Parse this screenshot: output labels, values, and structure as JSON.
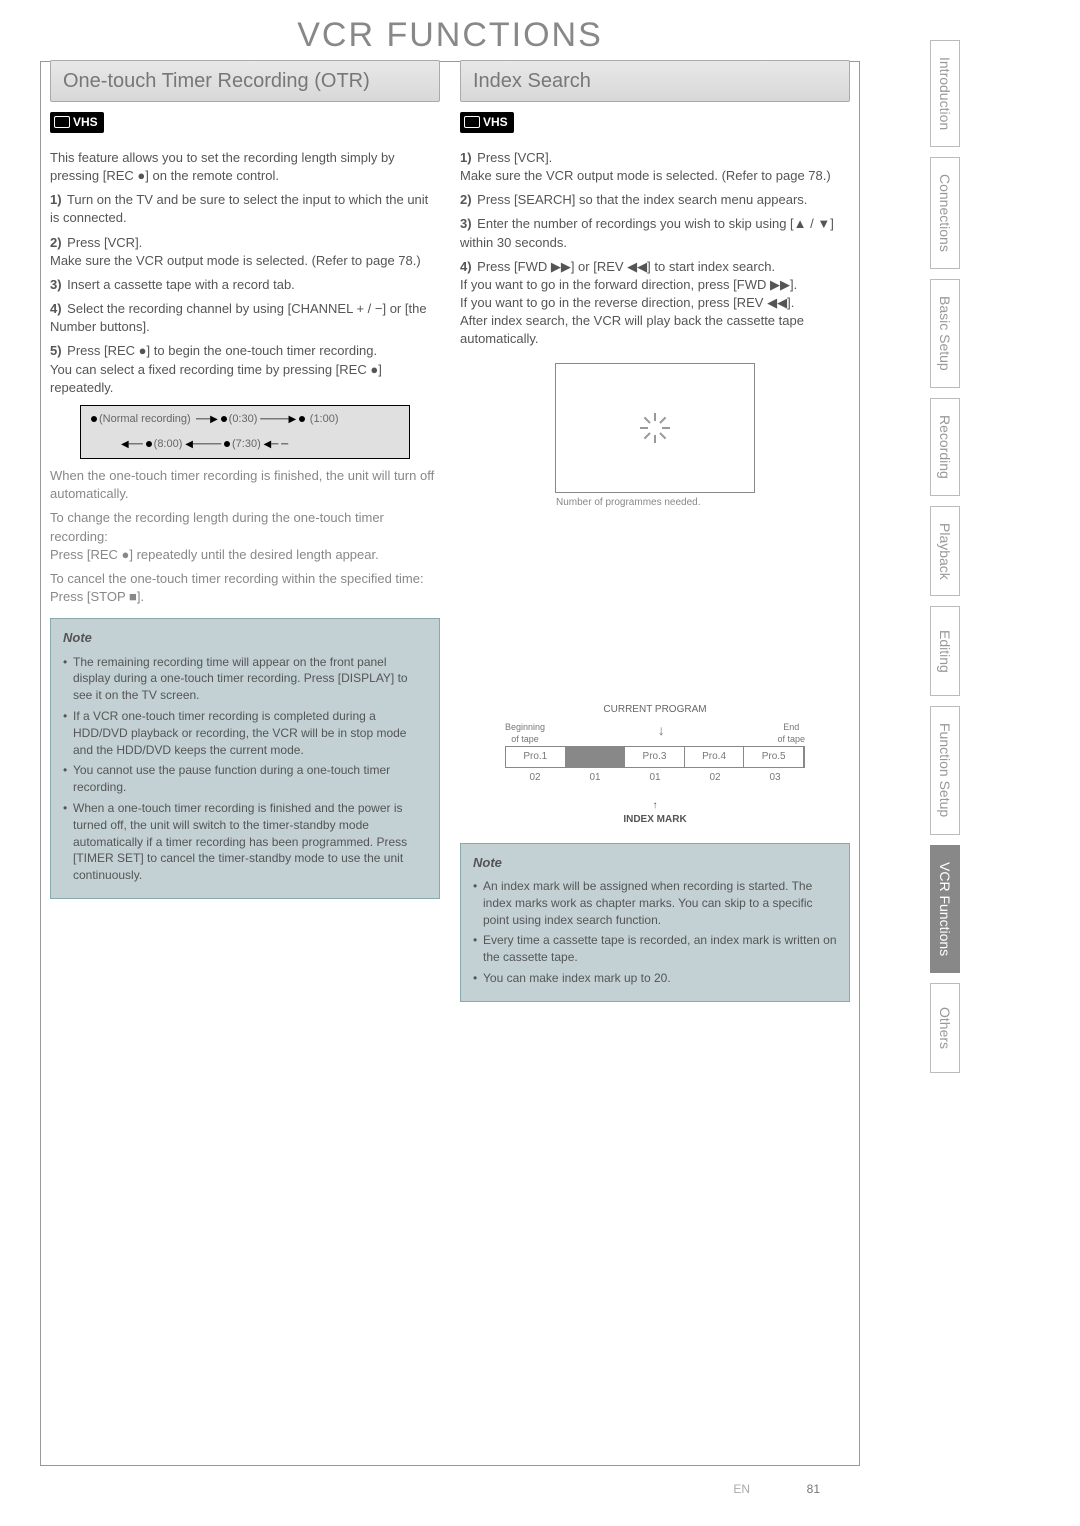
{
  "page_title": "VCR FUNCTIONS",
  "left": {
    "header": "One-touch Timer Recording (OTR)",
    "badge": "VHS",
    "intro": "This feature allows you to set the recording length simply by pressing [REC ●] on the remote control.",
    "steps": [
      "Turn on the TV and be sure to select the input to which the unit is connected.",
      "Press [VCR].\nMake sure the VCR output mode is selected. (Refer to page 78.)",
      "Insert a cassette tape with a record tab.",
      "Select the recording channel by using [CHANNEL + / −] or [the Number buttons].",
      "Press [REC ●] to begin the one-touch timer recording.\nYou can select a fixed recording time by pressing [REC ●] repeatedly."
    ],
    "timing_labels": {
      "normal": "(Normal recording)",
      "t030": "(0:30)",
      "t100": "(1:00)",
      "t730": "(7:30)",
      "t800": "(8:00)"
    },
    "after": "When the one-touch timer recording is finished, the unit will turn off automatically.",
    "change": "To change the recording length during the one-touch timer recording:\nPress [REC ●] repeatedly until the desired length appear.",
    "cancel": "To cancel the one-touch timer recording within the specified time:\nPress [STOP ■].",
    "note_title": "Note",
    "notes": [
      "The remaining recording time will appear on the front panel display during a one-touch timer recording. Press [DISPLAY] to see it on the TV screen.",
      "If a VCR one-touch timer recording is completed during a HDD/DVD playback or recording, the VCR will be in stop mode and the HDD/DVD keeps the current mode.",
      "You cannot use the pause function during a one-touch timer recording.",
      "When a one-touch timer recording is finished and the power is turned off, the unit will switch to the timer-standby mode automatically if a timer recording has been programmed. Press [TIMER SET] to cancel the timer-standby mode to use the unit continuously."
    ]
  },
  "right": {
    "header": "Index Search",
    "badge": "VHS",
    "steps": [
      "Press [VCR].\nMake sure the VCR output mode is selected. (Refer to page 78.)",
      "Press [SEARCH] so that the index search menu appears.",
      "Enter the number of recordings you wish to skip using [▲ / ▼] within 30 seconds.",
      "Press [FWD ▶▶] or [REV ◀◀] to start index search.\nIf you want to go in the forward direction, press [FWD ▶▶].\nIf you want to go in the reverse direction, press [REV ◀◀].\nAfter index search, the VCR will play back the cassette tape automatically."
    ],
    "diagram_ph": "Number of programmes needed.",
    "diagram_labels": {
      "title": "CURRENT PROGRAM",
      "begin": "Beginning\nof tape",
      "end": "End\nof tape",
      "pros": [
        "Pro.1",
        "",
        "Pro.3",
        "Pro.4",
        "Pro.5"
      ],
      "nums": [
        "02",
        "01",
        "01",
        "02",
        "03"
      ],
      "mark": "INDEX MARK"
    },
    "note_title": "Note",
    "notes": [
      "An index mark will be assigned when recording is started. The index marks work as chapter marks. You can skip to a specific point using index search function.",
      "Every time a cassette tape is recorded, an index mark is written on the cassette tape.",
      "You can make index mark up to 20."
    ]
  },
  "tabs": [
    "Introduction",
    "Connections",
    "Basic Setup",
    "Recording",
    "Playback",
    "Editing",
    "Function Setup",
    "VCR Functions",
    "Others"
  ],
  "active_tab": "VCR Functions",
  "page_num": "81",
  "lang": "EN"
}
